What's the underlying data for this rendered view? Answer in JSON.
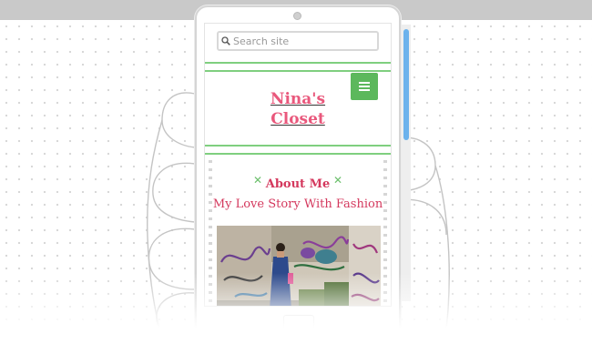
{
  "search": {
    "placeholder": "Search site"
  },
  "site": {
    "title_line1": "Nina's",
    "title_line2": "Closet"
  },
  "section": {
    "heading": "About Me",
    "post_title": "My Love Story With Fashion"
  },
  "colors": {
    "accent_pink": "#e9587c",
    "heading_red": "#d4385d",
    "menu_green": "#5cb85c",
    "rule_green": "#7fcf7f",
    "scroll_blue": "#6cb2ec"
  },
  "icons": {
    "search": "search-icon",
    "menu": "hamburger-menu-icon",
    "decor": "x-mark-icon"
  }
}
